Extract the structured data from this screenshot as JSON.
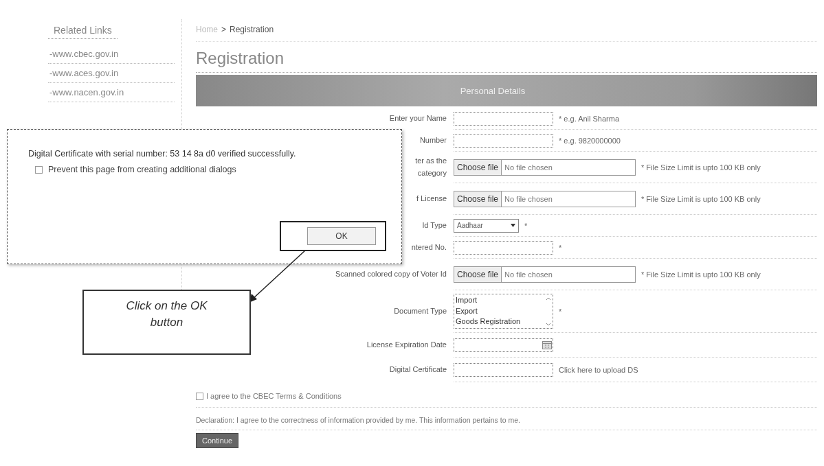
{
  "sidebar": {
    "title": "Related Links",
    "links": [
      {
        "text": "-www.cbec.gov.in"
      },
      {
        "text": "-www.aces.gov.in"
      },
      {
        "text": "-www.nacen.gov.in"
      }
    ]
  },
  "breadcrumb": {
    "items": [
      "Home",
      ">",
      "Registration"
    ]
  },
  "page_title": "Registration",
  "form": {
    "section_title": "Personal Details",
    "rows": [
      {
        "kind": "text",
        "label_lines": [
          "Enter your Name"
        ],
        "hint": "* e.g. Anil Sharma"
      },
      {
        "kind": "text",
        "label_lines": [
          "Number"
        ],
        "hint": "* e.g. 9820000000"
      },
      {
        "kind": "file",
        "label_lines": [
          "ter as the",
          "category"
        ],
        "button": "Choose file",
        "status": "No file chosen",
        "hint": "* File Size Limit is upto 100 KB only"
      },
      {
        "kind": "file",
        "label_lines": [
          "f License"
        ],
        "button": "Choose file",
        "status": "No file chosen",
        "hint": "* File Size Limit is upto 100 KB only"
      },
      {
        "kind": "select",
        "label_lines": [
          "ld Type"
        ],
        "value": "Aadhaar",
        "hint": "*"
      },
      {
        "kind": "text",
        "label_lines": [
          "ntered No."
        ],
        "hint": "*"
      },
      {
        "kind": "file",
        "label_lines": [
          "Scanned colored copy of Voter Id"
        ],
        "button": "Choose file",
        "status": "No file chosen",
        "hint": "* File Size Limit is upto 100 KB only"
      },
      {
        "kind": "listbox",
        "label_lines": [
          "Document Type"
        ],
        "options": [
          {
            "text": "Import",
            "selected": false
          },
          {
            "text": "Export",
            "selected": false
          },
          {
            "text": "Goods Registration",
            "selected": false
          }
        ],
        "hint": "*"
      },
      {
        "kind": "date",
        "label_lines": [
          "License Expiration Date"
        ]
      },
      {
        "kind": "text",
        "label_lines": [
          "Digital Certificate"
        ],
        "link": "Click here to upload DS"
      }
    ],
    "terms": {
      "label": "I agree to the CBEC Terms & Conditions",
      "checked": false
    },
    "declaration": "Declaration: I agree to the correctness of information provided by me. This information pertains to me.",
    "submit": "Continue"
  },
  "dialog": {
    "message": "Digital Certificate with serial number: 53 14 8a d0 verified successfully.",
    "checkbox": {
      "label": "Prevent this page from creating additional dialogs",
      "checked": false
    },
    "ok": "OK"
  },
  "callout": {
    "text": "Click on the OK button"
  }
}
